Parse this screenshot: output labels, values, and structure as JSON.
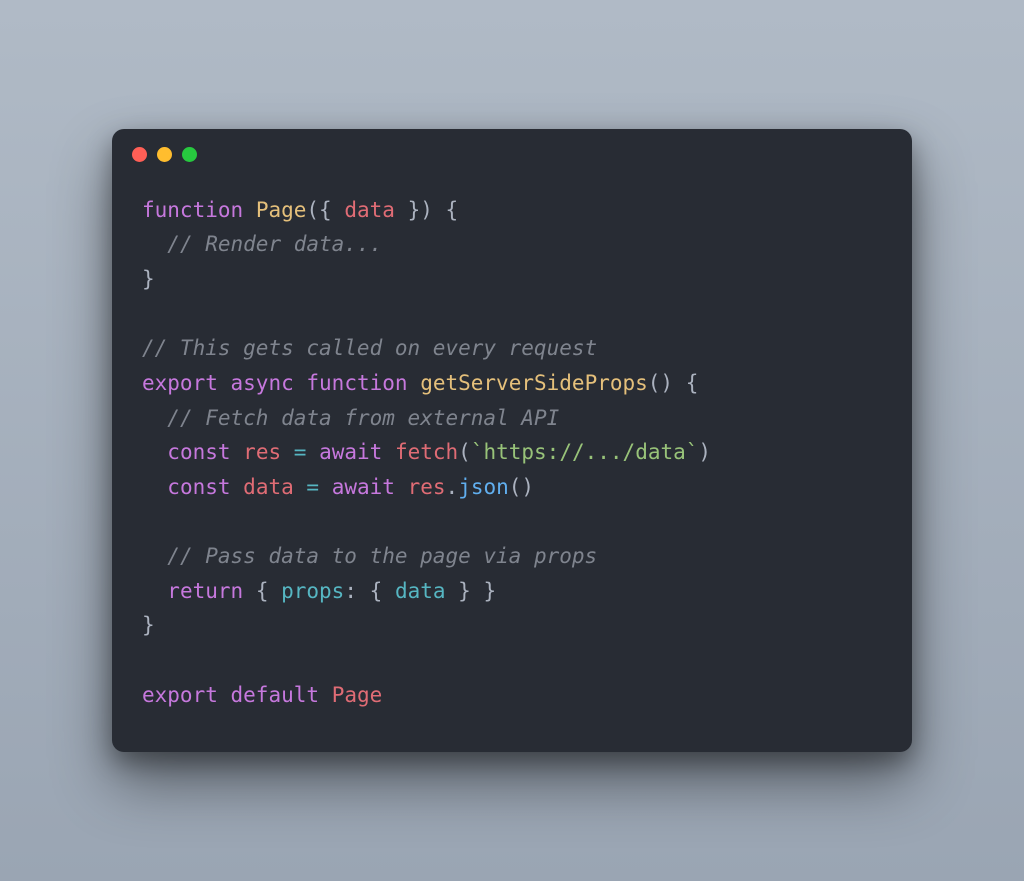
{
  "window": {
    "traffic_lights": {
      "close": "#ff5f56",
      "minimize": "#ffbd2e",
      "zoom": "#27c93f"
    }
  },
  "code": {
    "l1": {
      "kw_function": "function",
      "name_page": "Page",
      "paren_open": "(",
      "brace_open": "{ ",
      "param_data": "data",
      "brace_close": " }",
      "paren_close": ")",
      "space": " ",
      "body_open": "{"
    },
    "l2": {
      "indent": "  ",
      "comment": "// Render data..."
    },
    "l3": {
      "body_close": "}"
    },
    "l5": {
      "comment": "// This gets called on every request"
    },
    "l6": {
      "kw_export": "export",
      "sp1": " ",
      "kw_async": "async",
      "sp2": " ",
      "kw_function": "function",
      "sp3": " ",
      "name_gssp": "getServerSideProps",
      "parens": "()",
      "sp4": " ",
      "body_open": "{"
    },
    "l7": {
      "indent": "  ",
      "comment": "// Fetch data from external API"
    },
    "l8": {
      "indent": "  ",
      "kw_const": "const",
      "sp1": " ",
      "var_res": "res",
      "sp2": " ",
      "op_eq": "=",
      "sp3": " ",
      "kw_await": "await",
      "sp4": " ",
      "fn_fetch": "fetch",
      "paren_open": "(",
      "str_url": "`https://.../data`",
      "paren_close": ")"
    },
    "l9": {
      "indent": "  ",
      "kw_const": "const",
      "sp1": " ",
      "var_data": "data",
      "sp2": " ",
      "op_eq": "=",
      "sp3": " ",
      "kw_await": "await",
      "sp4": " ",
      "obj_res": "res",
      "dot": ".",
      "method_json": "json",
      "parens": "()"
    },
    "l11": {
      "indent": "  ",
      "comment": "// Pass data to the page via props"
    },
    "l12": {
      "indent": "  ",
      "kw_return": "return",
      "sp1": " ",
      "brace_open1": "{ ",
      "prop_props": "props",
      "colon": ":",
      "sp2": " ",
      "brace_open2": "{ ",
      "var_data": "data",
      "brace_close2": " }",
      "brace_close1": " }"
    },
    "l13": {
      "body_close": "}"
    },
    "l15": {
      "kw_export": "export",
      "sp1": " ",
      "kw_default": "default",
      "sp2": " ",
      "name_page": "Page"
    }
  }
}
